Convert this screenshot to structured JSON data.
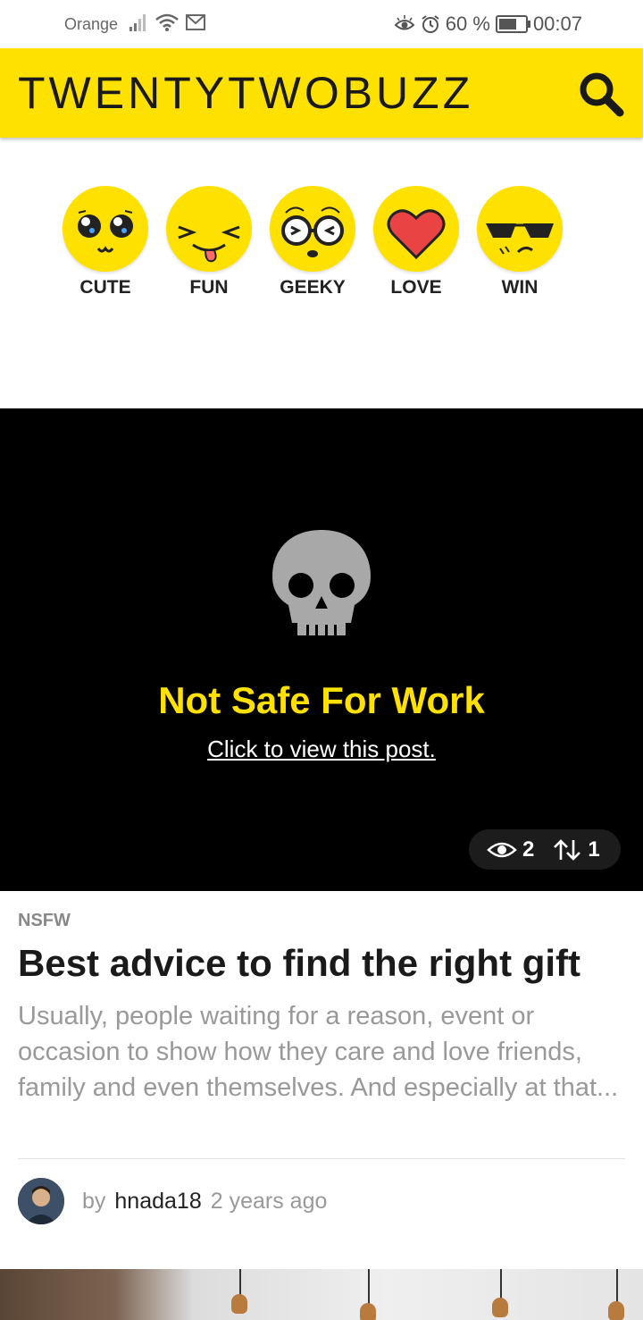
{
  "status_bar": {
    "carrier": "Orange",
    "battery": "60 %",
    "time": "00:07",
    "battery_level": 0.6
  },
  "header": {
    "brand": "TWENTYTWOBUZZ",
    "search_icon": "search-icon",
    "accent_color": "#ffe100"
  },
  "reactions": [
    {
      "label": "CUTE",
      "icon": "cute-face-icon"
    },
    {
      "label": "FUN",
      "icon": "fun-face-icon"
    },
    {
      "label": "GEEKY",
      "icon": "geeky-face-icon"
    },
    {
      "label": "LOVE",
      "icon": "heart-icon"
    },
    {
      "label": "WIN",
      "icon": "sunglasses-face-icon"
    }
  ],
  "nsfw": {
    "title": "Not Safe For Work",
    "link": "Click to view this post.",
    "views": "2",
    "votes": "1"
  },
  "post": {
    "category": "NSFW",
    "title": "Best advice to find the right gift",
    "excerpt": "Usually,  people waiting for a reason, event or occasion to show how they care  and love friends, family and even themselves. And especially at that...",
    "by": "by",
    "author": "hnada18",
    "time_ago": "2 years ago"
  }
}
